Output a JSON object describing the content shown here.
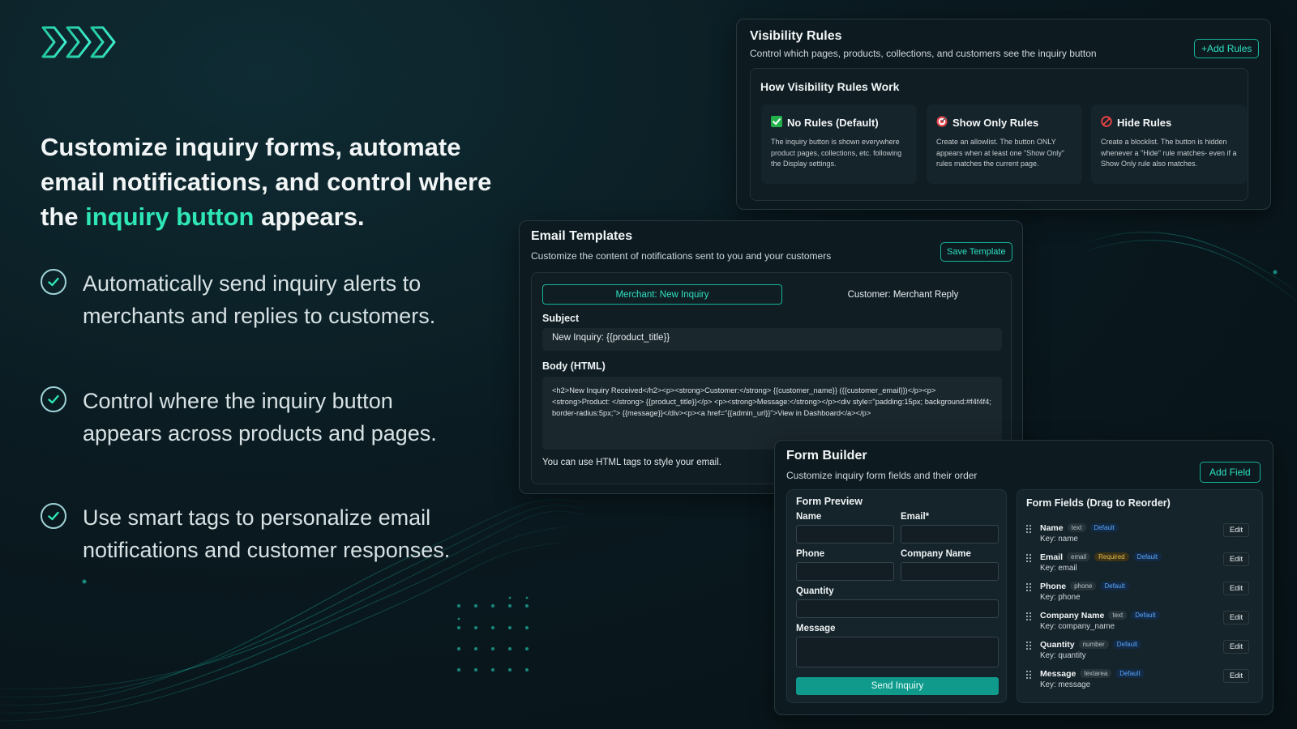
{
  "hero": {
    "headline_part1": "Customize inquiry forms, automate email notifications, and control where the ",
    "headline_accent": "inquiry button",
    "headline_part2": " appears.",
    "features": [
      "Automatically send inquiry alerts to merchants and replies to customers.",
      "Control where the inquiry button appears across products and pages.",
      "Use smart tags to personalize email notifications and customer responses."
    ]
  },
  "visibility": {
    "title": "Visibility Rules",
    "subtitle": "Control which pages, products, collections, and customers see the inquiry button",
    "add_button": "+Add Rules",
    "how_title": "How Visibility Rules Work",
    "cards": [
      {
        "title": "No Rules (Default)",
        "icon": "check-square-icon",
        "desc": "The inquiry button is shown everywhere product pages, collections, etc. following the Display settings."
      },
      {
        "title": "Show Only Rules",
        "icon": "target-icon",
        "desc": "Create an allowlist. The button ONLY appears when at least one \"Show Only\" rules matches the current page."
      },
      {
        "title": "Hide Rules",
        "icon": "prohibited-icon",
        "desc": "Create a blocklist. The button is hidden whenever a \"Hide\" rule matches- even if a Show Only rule also matches."
      }
    ]
  },
  "email": {
    "title": "Email Templates",
    "subtitle": "Customize the content of notifications sent to you and your customers",
    "save_button": "Save Template",
    "tabs": [
      "Merchant: New Inquiry",
      "Customer: Merchant Reply"
    ],
    "subject_label": "Subject",
    "subject_value": "New Inquiry: {{product_title}}",
    "body_label": "Body (HTML)",
    "body_value": "<h2>New Inquiry Received</h2><p><strong>Customer:</strong> {{customer_name}} ({{customer_email}})</p><p><strong>Product: </strong> {{product_title}}</p> <p><strong>Message:</strong></p><div style=\"padding:15px; background:#f4f4f4; border-radius:5px;\"> {{message}}</div><p><a href=\"{{admin_url}}\">View in Dashboard</a></p>",
    "hint": "You can use HTML tags to style your email."
  },
  "form_builder": {
    "title": "Form Builder",
    "subtitle": "Customize inquiry form fields and their order",
    "add_button": "Add Field",
    "preview_title": "Form Preview",
    "preview_labels": {
      "name": "Name",
      "email": "Email*",
      "phone": "Phone",
      "company": "Company Name",
      "quantity": "Quantity",
      "message": "Message"
    },
    "submit": "Send Inquiry",
    "fields_title": "Form Fields (Drag to Reorder)",
    "edit_label": "Edit",
    "fields": [
      {
        "name": "Name",
        "type": "text",
        "required": "",
        "default": "Default",
        "key": "Key: name"
      },
      {
        "name": "Email",
        "type": "email",
        "required": "Required",
        "default": "Default",
        "key": "Key: email"
      },
      {
        "name": "Phone",
        "type": "phone",
        "required": "",
        "default": "Default",
        "key": "Key: phone"
      },
      {
        "name": "Company Name",
        "type": "text",
        "required": "",
        "default": "Default",
        "key": "Key: company_name"
      },
      {
        "name": "Quantity",
        "type": "number",
        "required": "",
        "default": "Default",
        "key": "Key: quantity"
      },
      {
        "name": "Message",
        "type": "textarea",
        "required": "",
        "default": "Default",
        "key": "Key: message"
      }
    ]
  },
  "colors": {
    "accent": "#2ee6b6",
    "button": "#0f9a8c",
    "background": "#0a1a20"
  }
}
